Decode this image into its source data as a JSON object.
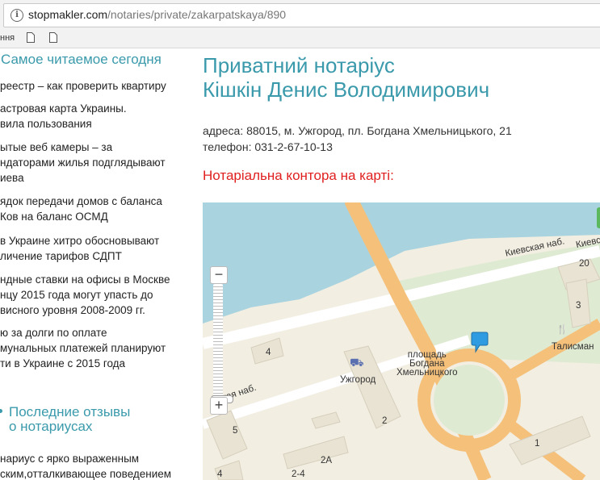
{
  "browser": {
    "url_host": "stopmakler.com",
    "url_path": "/notaries/private/zakarpatskaya/890",
    "bookmarks_text": "ння"
  },
  "sidebar": {
    "popular_heading": "Самое читаемое сегодня",
    "articles": [
      "реестр – как проверить квартиру",
      "астровая карта Украины.\nвила пользования",
      "ытые веб камеры – за\nндаторами жилья подглядывают\nиева",
      "ядок передачи домов с баланса\nКов на баланс ОСМД",
      "в Украине хитро обосновывают\nличение тарифов СДПТ",
      "ндные ставки на офисы в Москве\nнцу 2015 года могут упасть до\nвисного уровня 2008-2009 гг.",
      "ю за долги по оплате\nмунальных платежей планируют\nти в Украине с 2015 года"
    ],
    "reviews_heading": "Последние отзывы\nо нотариусах",
    "review_snippet": "нариус с ярко выраженным\nским,отталкивающее поведением"
  },
  "main": {
    "title_line1": "Приватний нотаріус",
    "title_line2": "Кішкін Денис Володимирович",
    "address": "адреса: 88015, м. Ужгород, пл. Богдана Хмельницького, 21",
    "phone": "телефон: 031-2-67-10-13",
    "map_heading": "Нотаріальна контора на карті:"
  },
  "map": {
    "labels": {
      "embankment_kyiv": "Киевская наб.",
      "embankment_kyiv_right": "Киевс",
      "embankment_left": "ьская наб.",
      "square": "площадь\nБогдана\nХмельницкого",
      "hotel": "Ужгород",
      "restaurant": "Талисман",
      "n4": "4",
      "n2": "2",
      "n5": "5",
      "n3": "3",
      "n20": "20",
      "n1": "1",
      "n2a": "2А",
      "n24": "2-4",
      "n4b": "4"
    },
    "zoom_in": "+",
    "zoom_out": "−"
  },
  "colors": {
    "accent": "#3a9aab",
    "heading_red": "#e02020",
    "water": "#a9d3df",
    "road": "#f5c07a",
    "park": "#dfead2"
  }
}
